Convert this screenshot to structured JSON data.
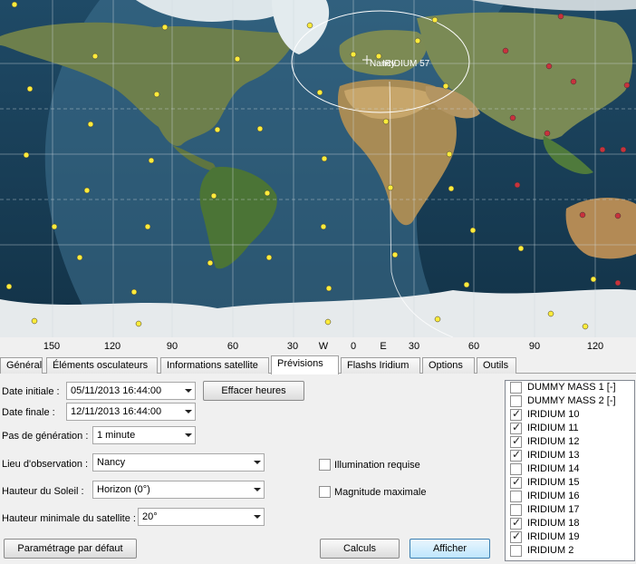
{
  "map": {
    "satellite_label": "IRIDIUM 57",
    "city_label": "Nancy",
    "sat_color": "#ffeb3b",
    "sat_red_color": "#c8323c",
    "axis_ticks": [
      "150",
      "120",
      "90",
      "60",
      "30",
      "W",
      "0",
      "E",
      "30",
      "60",
      "90",
      "120"
    ]
  },
  "tabs": [
    "Général",
    "Éléments osculateurs",
    "Informations satellite",
    "Prévisions",
    "Flashs Iridium",
    "Options",
    "Outils"
  ],
  "active_tab": "Prévisions",
  "form": {
    "date_initiale_label": "Date initiale :",
    "date_initiale_value": "05/11/2013 16:44:00",
    "date_finale_label": "Date finale :",
    "date_finale_value": "12/11/2013 16:44:00",
    "effacer_label": "Effacer heures",
    "pas_label": "Pas de génération :",
    "pas_value": "1 minute",
    "lieu_label": "Lieu d'observation :",
    "lieu_value": "Nancy",
    "hauteur_soleil_label": "Hauteur du Soleil :",
    "hauteur_soleil_value": "Horizon (0°)",
    "hauteur_min_label": "Hauteur minimale du satellite :",
    "hauteur_min_value": "20°",
    "illumination_label": "Illumination requise",
    "magnitude_label": "Magnitude maximale",
    "parametrage_label": "Paramétrage par défaut",
    "calculs_label": "Calculs",
    "afficher_label": "Afficher"
  },
  "satellites": [
    {
      "name": "DUMMY MASS 1 [-]",
      "checked": false
    },
    {
      "name": "DUMMY MASS 2 [-]",
      "checked": false
    },
    {
      "name": "IRIDIUM 10",
      "checked": true
    },
    {
      "name": "IRIDIUM 11",
      "checked": true
    },
    {
      "name": "IRIDIUM 12",
      "checked": true
    },
    {
      "name": "IRIDIUM 13",
      "checked": true
    },
    {
      "name": "IRIDIUM 14",
      "checked": false
    },
    {
      "name": "IRIDIUM 15",
      "checked": true
    },
    {
      "name": "IRIDIUM 16",
      "checked": false
    },
    {
      "name": "IRIDIUM 17",
      "checked": false
    },
    {
      "name": "IRIDIUM 18",
      "checked": true
    },
    {
      "name": "IRIDIUM 19",
      "checked": true
    },
    {
      "name": "IRIDIUM 2",
      "checked": false
    }
  ]
}
